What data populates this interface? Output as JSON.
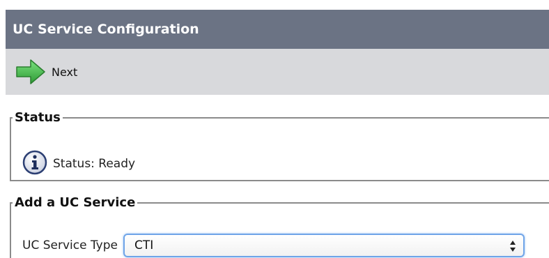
{
  "window": {
    "title": "UC Service Configuration"
  },
  "toolbar": {
    "next_label": "Next",
    "next_icon": "green-right-arrow"
  },
  "status_section": {
    "legend": "Status",
    "icon": "info-icon",
    "text": "Status: Ready"
  },
  "uc_section": {
    "legend": "Add a UC Service",
    "type_label": "UC Service Type",
    "type_value": "CTI"
  },
  "colors": {
    "titlebar": "#6b7384",
    "toolbar": "#d8d9dc",
    "arrow_green": "#3cb043",
    "select_focus": "#6fa4e8"
  }
}
